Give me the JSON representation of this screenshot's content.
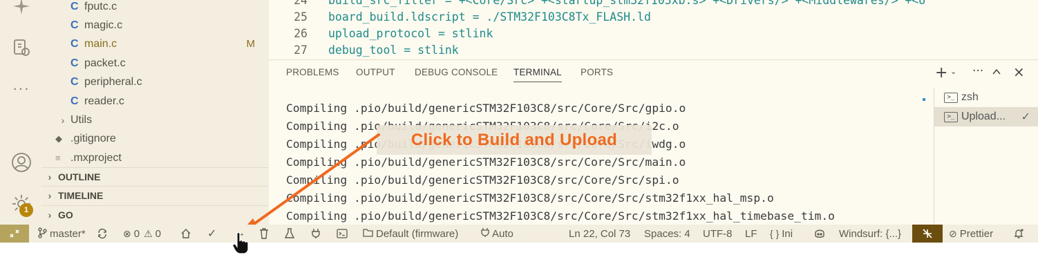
{
  "sidebar": {
    "files": [
      {
        "label": "fputc.c",
        "modified": ""
      },
      {
        "label": "magic.c",
        "modified": ""
      },
      {
        "label": "main.c",
        "modified": "M"
      },
      {
        "label": "packet.c",
        "modified": ""
      },
      {
        "label": "peripheral.c",
        "modified": ""
      },
      {
        "label": "reader.c",
        "modified": ""
      }
    ],
    "folder_utils": "Utils",
    "gitignore": ".gitignore",
    "mxproject": ".mxproject",
    "sections": [
      "OUTLINE",
      "TIMELINE",
      "GO"
    ],
    "c_glyph": "C",
    "settings_badge": "1"
  },
  "editor": {
    "lines": [
      {
        "num": "24",
        "text": "build_src_filter = +<Core/Src> +<startup_stm32f103xb.s> +<Drivers/> +<Middlewares/> +<U"
      },
      {
        "num": "25",
        "text": "board_build.ldscript = ./STM32F103C8Tx_FLASH.ld"
      },
      {
        "num": "26",
        "text": "upload_protocol = stlink"
      },
      {
        "num": "27",
        "text": "debug_tool = stlink"
      }
    ]
  },
  "panel": {
    "tabs": [
      "PROBLEMS",
      "OUTPUT",
      "DEBUG CONSOLE",
      "TERMINAL",
      "PORTS"
    ],
    "active_tab": "TERMINAL",
    "terminal_lines": [
      "Compiling .pio/build/genericSTM32F103C8/src/Core/Src/gpio.o",
      "Compiling .pio/build/genericSTM32F103C8/src/Core/Src/i2c.o",
      "Compiling .pio/build/genericSTM32F103C8/src/Core/Src/iwdg.o",
      "Compiling .pio/build/genericSTM32F103C8/src/Core/Src/main.o",
      "Compiling .pio/build/genericSTM32F103C8/src/Core/Src/spi.o",
      "Compiling .pio/build/genericSTM32F103C8/src/Core/Src/stm32f1xx_hal_msp.o",
      "Compiling .pio/build/genericSTM32F103C8/src/Core/Src/stm32f1xx_hal_timebase_tim.o"
    ],
    "terminals": [
      {
        "label": "zsh",
        "selected": false
      },
      {
        "label": "Upload...",
        "selected": true
      }
    ],
    "actions": {
      "add": "+",
      "more": "···",
      "maximize": "^",
      "close": "×",
      "check": "✓"
    }
  },
  "callout": {
    "text": "Click to Build and Upload"
  },
  "statusbar": {
    "branch": "master*",
    "errors": "0",
    "warnings": "0",
    "env": "Default (firmware)",
    "port": "Auto",
    "position": "Ln 22, Col 73",
    "spaces": "Spaces: 4",
    "encoding": "UTF-8",
    "eol": "LF",
    "language": "Ini",
    "language_braces": "{ }",
    "windsurf": "Windsurf: {...}",
    "prettier": "Prettier"
  },
  "colors": {
    "accent_orange": "#ef6a1f",
    "sidebar_bg": "#f3eee0",
    "editor_bg": "#fdfaf0",
    "code_teal": "#1f8b8b"
  }
}
